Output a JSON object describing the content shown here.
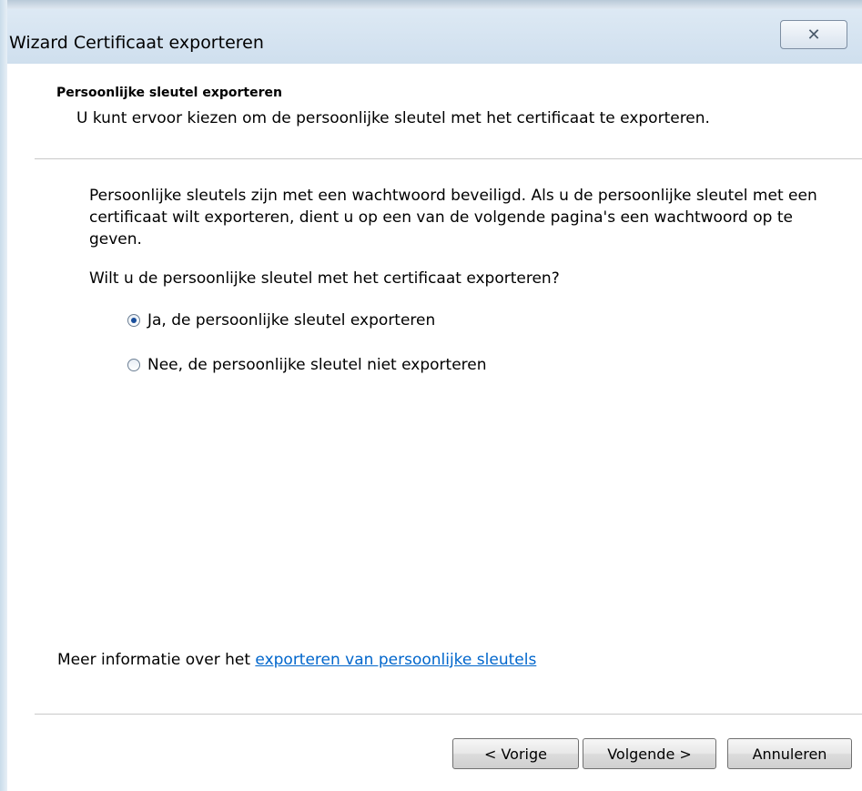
{
  "window": {
    "title": "Wizard Certificaat exporteren",
    "close_glyph": "✕"
  },
  "header": {
    "title": "Persoonlijke sleutel exporteren",
    "subtitle": "U kunt ervoor kiezen om de persoonlijke sleutel met het certificaat te exporteren."
  },
  "body": {
    "description": "Persoonlijke sleutels zijn met een wachtwoord beveiligd. Als u de persoonlijke sleutel met een certificaat wilt exporteren, dient u op een van de volgende pagina's een wachtwoord op te geven.",
    "question": "Wilt u de persoonlijke sleutel met het certificaat exporteren?",
    "options": [
      {
        "label": "Ja, de persoonlijke sleutel exporteren",
        "selected": true
      },
      {
        "label": "Nee, de persoonlijke sleutel niet exporteren",
        "selected": false
      }
    ]
  },
  "info": {
    "prefix": "Meer informatie over het ",
    "link_text": "exporteren van persoonlijke sleutels"
  },
  "buttons": {
    "back": "< Vorige",
    "next": "Volgende >",
    "cancel": "Annuleren"
  },
  "colors": {
    "link": "#0066cc",
    "titlebar": "#d7e4f1"
  }
}
